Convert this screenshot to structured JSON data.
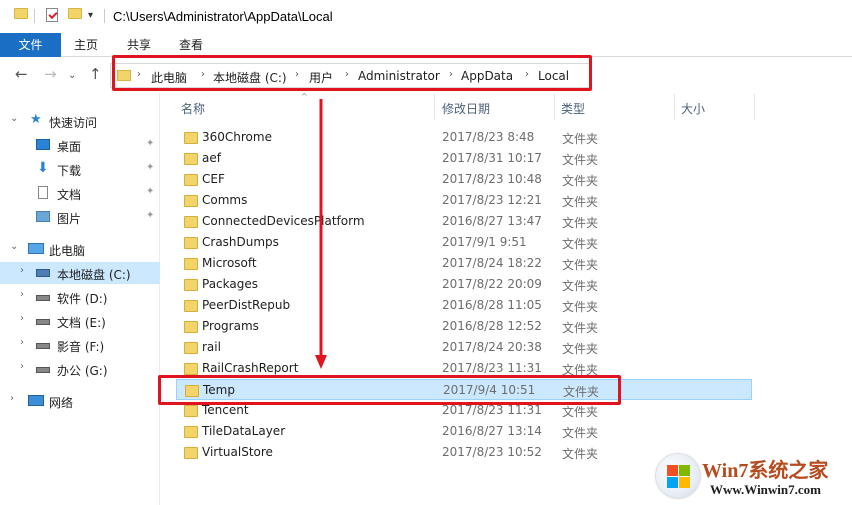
{
  "window": {
    "title": "C:\\Users\\Administrator\\AppData\\Local"
  },
  "ribbon": {
    "tabs": [
      {
        "label": "文件"
      },
      {
        "label": "主页"
      },
      {
        "label": "共享"
      },
      {
        "label": "查看"
      }
    ]
  },
  "address": {
    "crumbs": [
      "此电脑",
      "本地磁盘 (C:)",
      "用户",
      "Administrator",
      "AppData",
      "Local"
    ]
  },
  "navpane": {
    "quick_access": {
      "label": "快速访问"
    },
    "quick_items": [
      {
        "label": "桌面"
      },
      {
        "label": "下载"
      },
      {
        "label": "文档"
      },
      {
        "label": "图片"
      }
    ],
    "this_pc": {
      "label": "此电脑"
    },
    "drives": [
      {
        "label": "本地磁盘 (C:)"
      },
      {
        "label": "软件 (D:)"
      },
      {
        "label": "文档 (E:)"
      },
      {
        "label": "影音 (F:)"
      },
      {
        "label": "办公 (G:)"
      }
    ],
    "network": {
      "label": "网络"
    }
  },
  "filelist": {
    "columns": [
      "名称",
      "修改日期",
      "类型",
      "大小"
    ],
    "rows": [
      {
        "name": "360Chrome",
        "date": "2017/8/23 8:48",
        "type": "文件夹"
      },
      {
        "name": "aef",
        "date": "2017/8/31 10:17",
        "type": "文件夹"
      },
      {
        "name": "CEF",
        "date": "2017/8/23 10:48",
        "type": "文件夹"
      },
      {
        "name": "Comms",
        "date": "2017/8/23 12:21",
        "type": "文件夹"
      },
      {
        "name": "ConnectedDevicesPlatform",
        "date": "2016/8/27 13:47",
        "type": "文件夹"
      },
      {
        "name": "CrashDumps",
        "date": "2017/9/1 9:51",
        "type": "文件夹"
      },
      {
        "name": "Microsoft",
        "date": "2017/8/24 18:22",
        "type": "文件夹"
      },
      {
        "name": "Packages",
        "date": "2017/8/22 20:09",
        "type": "文件夹"
      },
      {
        "name": "PeerDistRepub",
        "date": "2016/8/28 11:05",
        "type": "文件夹"
      },
      {
        "name": "Programs",
        "date": "2016/8/28 12:52",
        "type": "文件夹"
      },
      {
        "name": "rail",
        "date": "2017/8/24 20:38",
        "type": "文件夹"
      },
      {
        "name": "RailCrashReport",
        "date": "2017/8/23 11:31",
        "type": "文件夹"
      },
      {
        "name": "Temp",
        "date": "2017/9/4 10:51",
        "type": "文件夹"
      },
      {
        "name": "Tencent",
        "date": "2017/8/23 11:31",
        "type": "文件夹"
      },
      {
        "name": "TileDataLayer",
        "date": "2016/8/27 13:14",
        "type": "文件夹"
      },
      {
        "name": "VirtualStore",
        "date": "2017/8/23 10:52",
        "type": "文件夹"
      }
    ],
    "selected_index": 12
  },
  "watermark": {
    "title": "Win7系统之家",
    "url": "Www.Winwin7.com"
  },
  "colors": {
    "accent": "#1a6fc4",
    "selection": "#cce8ff",
    "annotation": "#e0141e"
  }
}
